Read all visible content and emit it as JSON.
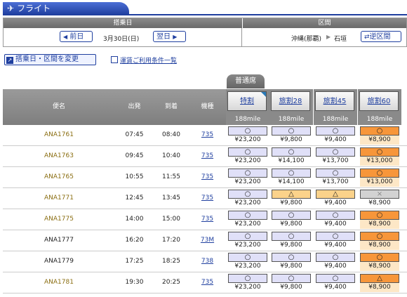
{
  "header": {
    "title": "フライト",
    "plane_icon": "airplane-icon"
  },
  "selection": {
    "date_header": "搭乗日",
    "route_header": "区間",
    "prev_label": "前日",
    "date": "3月30日(日)",
    "next_label": "翌日",
    "from": "沖縄(那覇)",
    "to": "石垣",
    "reverse_label": "逆区間"
  },
  "change_label": "搭乗日・区間を変更",
  "terms_link": "運賃ご利用条件一覧",
  "seat_class": "普通席",
  "columns": {
    "flight": "便名",
    "dep": "出発",
    "arr": "到着",
    "equip": "機種"
  },
  "fares": [
    {
      "name": "特割",
      "mile": "188mile"
    },
    {
      "name": "旅割28",
      "mile": "188mile"
    },
    {
      "name": "旅割45",
      "mile": "188mile"
    },
    {
      "name": "旅割60",
      "mile": "188mile"
    }
  ],
  "flights": [
    {
      "no": "ANA1761",
      "dep": "07:45",
      "arr": "08:40",
      "eq": "735",
      "f": [
        [
          "○",
          "¥23,200"
        ],
        [
          "○",
          "¥9,800"
        ],
        [
          "○",
          "¥9,400"
        ],
        [
          "○",
          "¥8,900"
        ]
      ]
    },
    {
      "no": "ANA1763",
      "dep": "09:45",
      "arr": "10:40",
      "eq": "735",
      "f": [
        [
          "○",
          "¥23,200"
        ],
        [
          "○",
          "¥14,100"
        ],
        [
          "○",
          "¥13,700"
        ],
        [
          "○",
          "¥13,000"
        ]
      ]
    },
    {
      "no": "ANA1765",
      "dep": "10:55",
      "arr": "11:55",
      "eq": "735",
      "f": [
        [
          "○",
          "¥23,200"
        ],
        [
          "○",
          "¥14,100"
        ],
        [
          "○",
          "¥13,700"
        ],
        [
          "○",
          "¥13,000"
        ]
      ]
    },
    {
      "no": "ANA1771",
      "dep": "12:45",
      "arr": "13:45",
      "eq": "735",
      "f": [
        [
          "○",
          "¥23,200"
        ],
        [
          "△",
          "¥9,800"
        ],
        [
          "△",
          "¥9,400"
        ],
        [
          "×",
          "¥8,900"
        ]
      ]
    },
    {
      "no": "ANA1775",
      "dep": "14:00",
      "arr": "15:00",
      "eq": "735",
      "f": [
        [
          "○",
          "¥23,200"
        ],
        [
          "○",
          "¥9,800"
        ],
        [
          "○",
          "¥9,400"
        ],
        [
          "○",
          "¥8,900"
        ]
      ]
    },
    {
      "no": "ANA1777",
      "dep": "16:20",
      "arr": "17:20",
      "eq": "73M",
      "f": [
        [
          "○",
          "¥23,200"
        ],
        [
          "○",
          "¥9,800"
        ],
        [
          "○",
          "¥9,400"
        ],
        [
          "○",
          "¥8,900"
        ]
      ]
    },
    {
      "no": "ANA1779",
      "dep": "17:25",
      "arr": "18:25",
      "eq": "738",
      "f": [
        [
          "○",
          "¥23,200"
        ],
        [
          "○",
          "¥9,800"
        ],
        [
          "○",
          "¥9,400"
        ],
        [
          "○",
          "¥8,900"
        ]
      ]
    },
    {
      "no": "ANA1781",
      "dep": "19:30",
      "arr": "20:25",
      "eq": "735",
      "f": [
        [
          "○",
          "¥23,200"
        ],
        [
          "○",
          "¥9,800"
        ],
        [
          "○",
          "¥9,400"
        ],
        [
          "△",
          "¥8,900"
        ]
      ]
    }
  ]
}
